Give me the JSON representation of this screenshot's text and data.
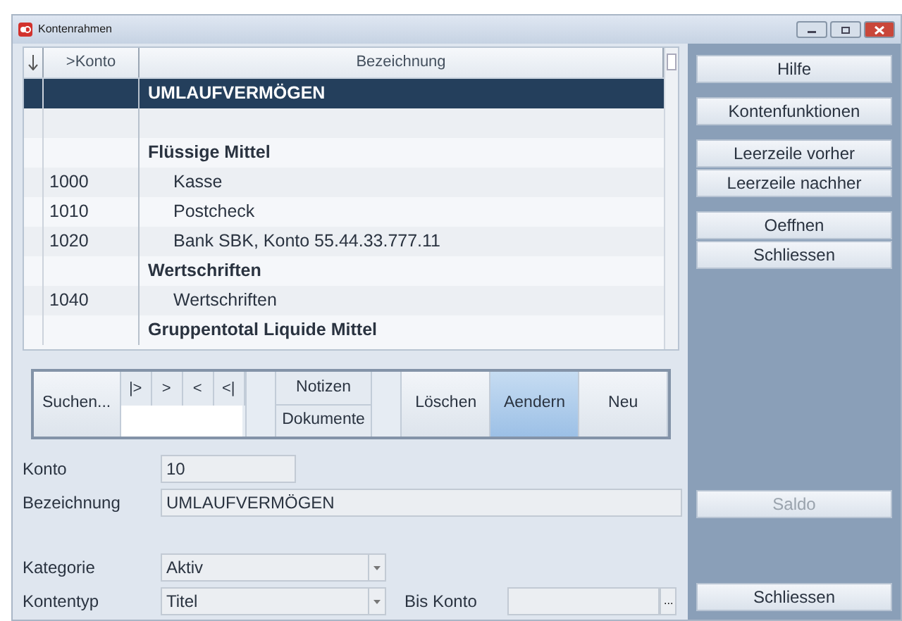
{
  "window": {
    "title": "Kontenrahmen"
  },
  "table": {
    "columns": [
      ">Konto",
      "Bezeichnung"
    ],
    "rows": [
      {
        "kind": "group",
        "bezeichnung": "UMLAUFVERMÖGEN",
        "selected": true
      },
      {
        "kind": "blank",
        "selected": false
      },
      {
        "kind": "group",
        "bezeichnung": "Flüssige Mittel",
        "selected": false
      },
      {
        "kind": "account",
        "konto": "1000",
        "bezeichnung": "Kasse",
        "selected": false
      },
      {
        "kind": "account",
        "konto": "1010",
        "bezeichnung": "Postcheck",
        "selected": false
      },
      {
        "kind": "account",
        "konto": "1020",
        "bezeichnung": "Bank SBK, Konto 55.44.33.777.11",
        "selected": false
      },
      {
        "kind": "group",
        "bezeichnung": "Wertschriften",
        "selected": false
      },
      {
        "kind": "account",
        "konto": "1040",
        "bezeichnung": "Wertschriften",
        "selected": false
      },
      {
        "kind": "group",
        "bezeichnung": "Gruppentotal Liquide Mittel",
        "selected": false
      }
    ]
  },
  "toolbar": {
    "search": {
      "label": "Suchen..."
    },
    "nav": [
      "|>",
      ">",
      "<",
      "<|"
    ],
    "notes": "Notizen",
    "documents": "Dokumente",
    "actions": [
      {
        "label": "Löschen",
        "pressed": false
      },
      {
        "label": "Aendern",
        "pressed": true
      },
      {
        "label": "Neu",
        "pressed": false
      }
    ]
  },
  "form": {
    "konto": {
      "label": "Konto",
      "value": "10"
    },
    "bezeichnung": {
      "label": "Bezeichnung",
      "value": "UMLAUFVERMÖGEN"
    },
    "kategorie": {
      "label": "Kategorie",
      "value": "Aktiv"
    },
    "kontentyp": {
      "label": "Kontentyp",
      "value": "Titel"
    },
    "bis_konto": {
      "label": "Bis Konto",
      "browse": "..."
    }
  },
  "side_button_groups": [
    {
      "kind": "top",
      "buttons": [
        {
          "label": "Hilfe",
          "disabled": false
        }
      ]
    },
    {
      "kind": "top",
      "buttons": [
        {
          "label": "Kontenfunktionen",
          "disabled": false
        }
      ]
    },
    {
      "kind": "top",
      "buttons": [
        {
          "label": "Leerzeile vorher",
          "disabled": false
        },
        {
          "label": "Leerzeile nachher",
          "disabled": false
        }
      ]
    },
    {
      "kind": "top",
      "buttons": [
        {
          "label": "Oeffnen",
          "disabled": false
        },
        {
          "label": "Schliessen",
          "disabled": false
        }
      ]
    },
    {
      "kind": "bottom",
      "buttons": [
        {
          "label": "Saldo",
          "disabled": true
        }
      ]
    },
    {
      "kind": "bottom",
      "buttons": [
        {
          "label": "Schliessen",
          "disabled": false
        }
      ]
    }
  ]
}
